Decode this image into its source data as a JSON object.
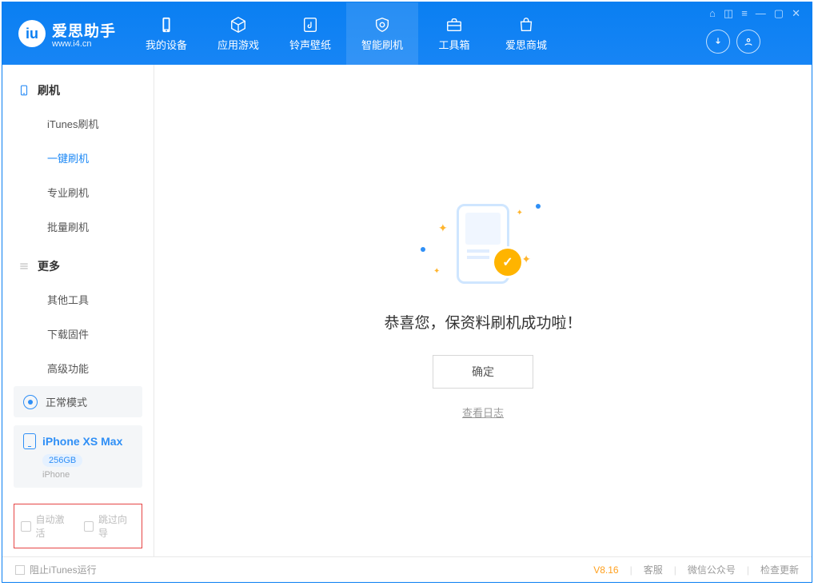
{
  "app": {
    "name": "爱思助手",
    "url": "www.i4.cn"
  },
  "nav": {
    "items": [
      {
        "label": "我的设备"
      },
      {
        "label": "应用游戏"
      },
      {
        "label": "铃声壁纸"
      },
      {
        "label": "智能刷机"
      },
      {
        "label": "工具箱"
      },
      {
        "label": "爱思商城"
      }
    ]
  },
  "sidebar": {
    "group1": {
      "title": "刷机",
      "items": [
        {
          "label": "iTunes刷机"
        },
        {
          "label": "一键刷机"
        },
        {
          "label": "专业刷机"
        },
        {
          "label": "批量刷机"
        }
      ]
    },
    "group2": {
      "title": "更多",
      "items": [
        {
          "label": "其他工具"
        },
        {
          "label": "下载固件"
        },
        {
          "label": "高级功能"
        }
      ]
    },
    "mode": "正常模式",
    "device": {
      "name": "iPhone XS Max",
      "capacity": "256GB",
      "type": "iPhone"
    },
    "checks": {
      "auto_activate": "自动激活",
      "skip_guide": "跳过向导"
    }
  },
  "main": {
    "message": "恭喜您，保资料刷机成功啦！",
    "ok": "确定",
    "log_link": "查看日志"
  },
  "footer": {
    "block_itunes": "阻止iTunes运行",
    "version": "V8.16",
    "links": {
      "support": "客服",
      "wechat": "微信公众号",
      "update": "检查更新"
    }
  }
}
